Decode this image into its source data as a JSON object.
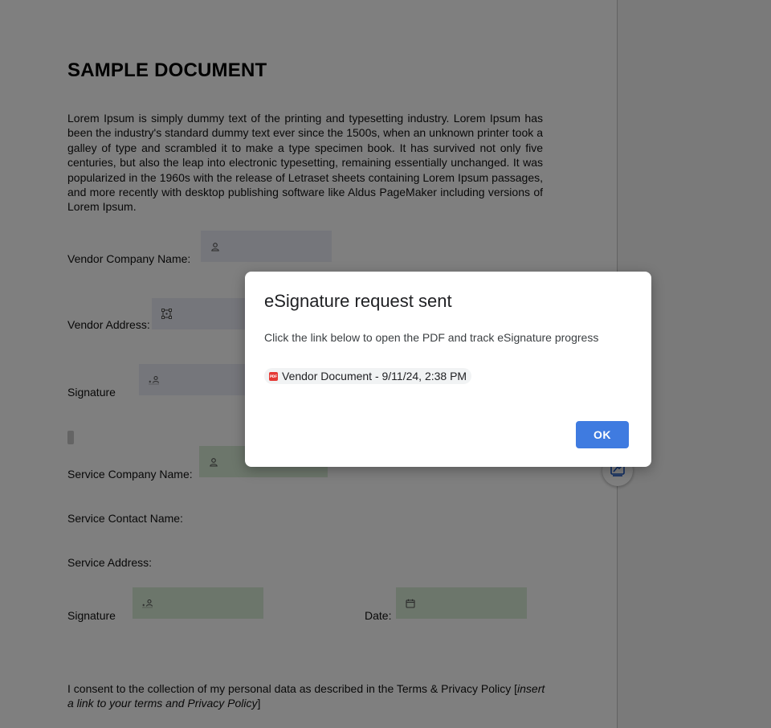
{
  "document": {
    "title": "SAMPLE DOCUMENT",
    "body": "Lorem Ipsum is simply dummy text of the printing and typesetting industry. Lorem Ipsum has been the industry's standard dummy text ever since the 1500s, when an unknown printer took a galley of type and scrambled it to make a type specimen book. It has survived not only five centuries, but also the leap into electronic typesetting, remaining essentially unchanged. It was popularized in the 1960s with the release of Letraset sheets containing Lorem Ipsum passages, and more recently with desktop publishing software like Aldus PageMaker including versions of Lorem Ipsum.",
    "labels": {
      "vendor_company_name": "Vendor Company Name:",
      "vendor_address": "Vendor Address:",
      "vendor_signature": "Signature",
      "service_company_name": "Service Company Name:",
      "service_contact_name": "Service Contact Name:",
      "service_address": "Service Address:",
      "service_signature": "Signature",
      "date": "Date:"
    },
    "consent_text": "I consent to the collection of my personal data as described in the Terms & Privacy Policy [",
    "consent_link_text": "insert a link to your terms and Privacy Policy",
    "consent_end": "]"
  },
  "dialog": {
    "title": "eSignature request sent",
    "message": "Click the link below to open the PDF and track eSignature progress",
    "file_icon_text": "PDF",
    "file_chip_label": "Vendor Document - 9/11/24, 2:38 PM",
    "ok_label": "OK"
  },
  "colors": {
    "vendor_field": "#eaedf7",
    "service_field": "#d9ecd6",
    "ok_button": "#3f7be0",
    "pdf_icon": "#e53935"
  },
  "icons": {
    "name_field": "person-icon",
    "address_field": "address-icon",
    "signature_field": "signature-icon",
    "date_field": "calendar-icon",
    "fab": "esignature-icon"
  }
}
